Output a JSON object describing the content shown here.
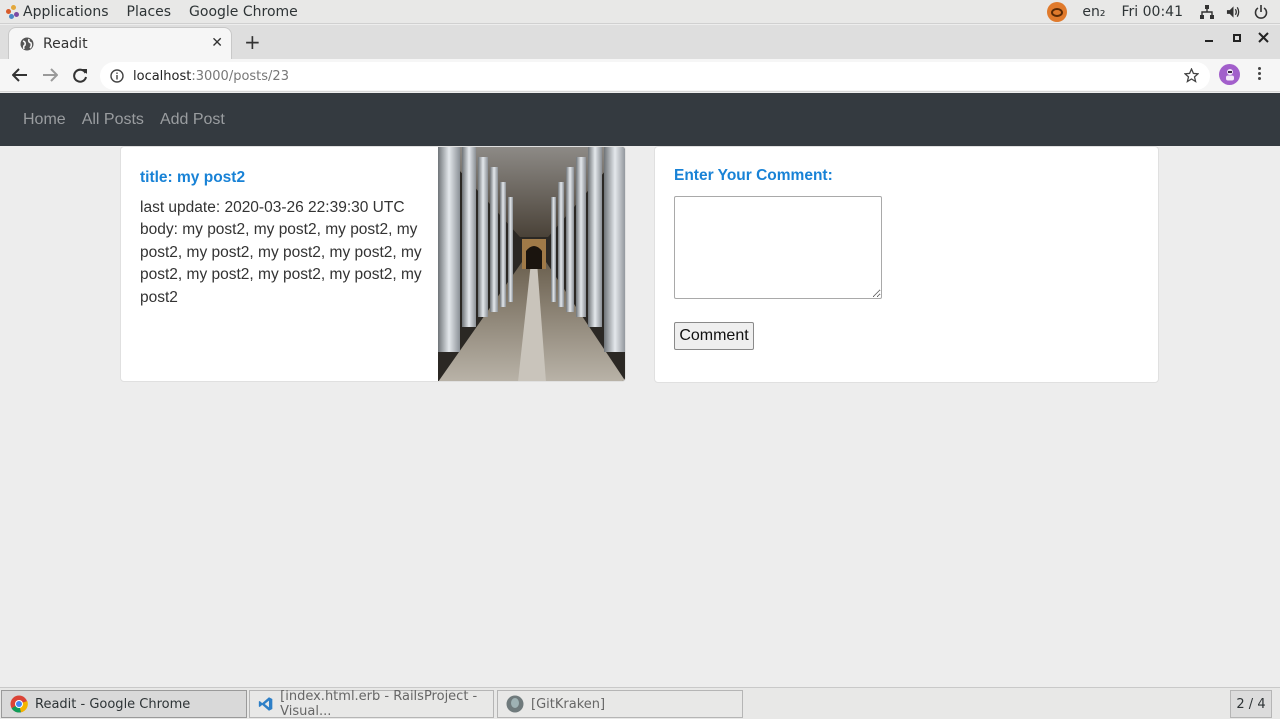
{
  "topbar": {
    "menu": [
      "Applications",
      "Places",
      "Google Chrome"
    ],
    "language": "en₂",
    "clock": "Fri 00:41"
  },
  "browser": {
    "tab_title": "Readit",
    "url_host": "localhost",
    "url_path": ":3000/posts/23"
  },
  "navbar": {
    "links": [
      "Home",
      "All Posts",
      "Add Post"
    ]
  },
  "post": {
    "title": "title: my post2",
    "updated": "last update: 2020-03-26 22:39:30 UTC",
    "body": "body: my post2, my post2, my post2, my post2, my post2, my post2, my post2, my post2, my post2, my post2, my post2, my post2"
  },
  "comment": {
    "label": "Enter Your Comment:",
    "value": "",
    "button": "Comment"
  },
  "taskbar": {
    "tasks": [
      "Readit - Google Chrome",
      "[index.html.erb - RailsProject - Visual...",
      "[GitKraken]"
    ],
    "workspace": "2 / 4"
  }
}
